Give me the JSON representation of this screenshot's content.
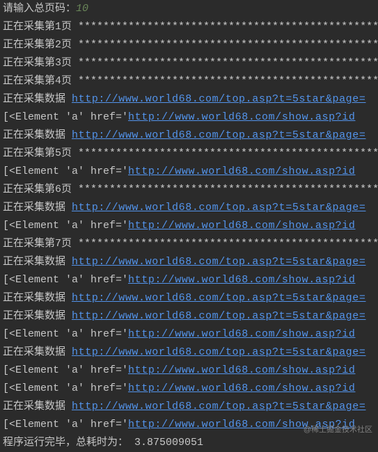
{
  "prompt": {
    "label": "请输入总页码：",
    "value": "10"
  },
  "stars": "***************************************************",
  "lines": [
    {
      "type": "prompt"
    },
    {
      "type": "page_stars",
      "pre": "正在采集第1页  "
    },
    {
      "type": "page_stars",
      "pre": "正在采集第2页  "
    },
    {
      "type": "page_stars",
      "pre": "正在采集第3页  "
    },
    {
      "type": "page_stars",
      "pre": "正在采集第4页  "
    },
    {
      "type": "data_link",
      "pre": "正在采集数据  ",
      "url": "http://www.world68.com/top.asp?t=5star&page="
    },
    {
      "type": "elem_link",
      "pre": "[<Element 'a' href='",
      "url": "http://www.world68.com/show.asp?id"
    },
    {
      "type": "data_link",
      "pre": "正在采集数据  ",
      "url": "http://www.world68.com/top.asp?t=5star&page="
    },
    {
      "type": "page_stars",
      "pre": "正在采集第5页  "
    },
    {
      "type": "elem_link",
      "pre": "[<Element 'a' href='",
      "url": "http://www.world68.com/show.asp?id"
    },
    {
      "type": "page_stars",
      "pre": "正在采集第6页  "
    },
    {
      "type": "data_link",
      "pre": "正在采集数据  ",
      "url": "http://www.world68.com/top.asp?t=5star&page="
    },
    {
      "type": "elem_link",
      "pre": "[<Element 'a' href='",
      "url": "http://www.world68.com/show.asp?id"
    },
    {
      "type": "page_stars",
      "pre": "正在采集第7页  "
    },
    {
      "type": "data_link",
      "pre": "正在采集数据  ",
      "url": "http://www.world68.com/top.asp?t=5star&page="
    },
    {
      "type": "elem_link",
      "pre": "[<Element 'a' href='",
      "url": "http://www.world68.com/show.asp?id"
    },
    {
      "type": "data_link2",
      "pre": "正在采集数据   ",
      "url": "http://www.world68.com/top.asp?t=5star&page="
    },
    {
      "type": "data_link",
      "pre": "正在采集数据  ",
      "url": "http://www.world68.com/top.asp?t=5star&page="
    },
    {
      "type": "elem_link",
      "pre": "[<Element 'a' href='",
      "url": "http://www.world68.com/show.asp?id"
    },
    {
      "type": "data_link",
      "pre": "正在采集数据  ",
      "url": "http://www.world68.com/top.asp?t=5star&page="
    },
    {
      "type": "elem_link",
      "pre": "[<Element 'a' href='",
      "url": "http://www.world68.com/show.asp?id"
    },
    {
      "type": "elem_link",
      "pre": "[<Element 'a' href='",
      "url": "http://www.world68.com/show.asp?id"
    },
    {
      "type": "data_link",
      "pre": "正在采集数据  ",
      "url": "http://www.world68.com/top.asp?t=5star&page="
    },
    {
      "type": "elem_link",
      "pre": "[<Element 'a' href='",
      "url": "http://www.world68.com/show.asp?id"
    },
    {
      "type": "finish",
      "pre": "程序运行完毕，总耗时为：  ",
      "value": "3.875009051"
    }
  ],
  "watermark": "@稀土掘金技术社区"
}
